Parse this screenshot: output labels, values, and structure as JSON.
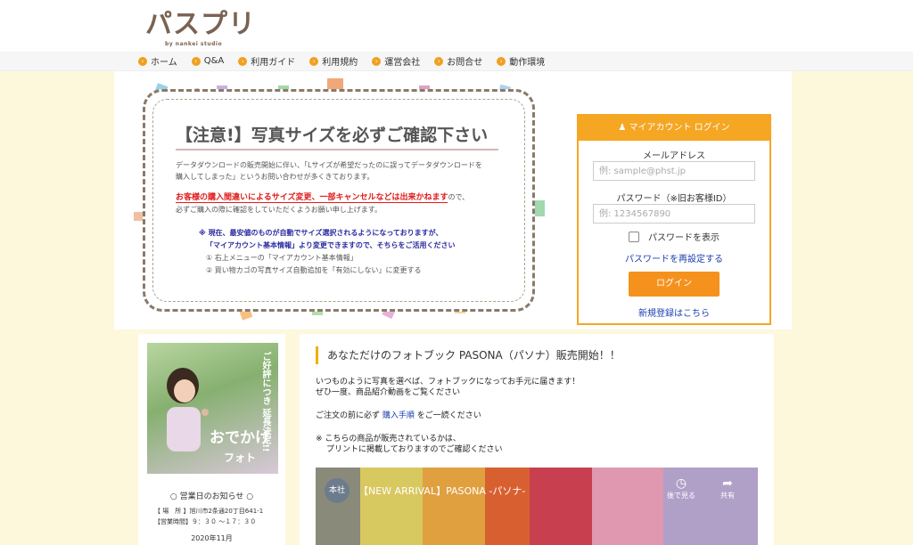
{
  "logo": {
    "main": "パスプリ",
    "sub": "by nankei studio"
  },
  "nav": {
    "items": [
      {
        "label": "ホーム"
      },
      {
        "label": "Q&A"
      },
      {
        "label": "利用ガイド"
      },
      {
        "label": "利用規約"
      },
      {
        "label": "運営会社"
      },
      {
        "label": "お問合せ"
      },
      {
        "label": "動作環境"
      }
    ]
  },
  "notice": {
    "title": "【注意!】写真サイズを必ずご確認下さい",
    "line1": "データダウンロードの販売開始に伴い、「Lサイズが希望だったのに誤ってデータダウンロードを",
    "line2": "購入してしまった」というお問い合わせが多くきております。",
    "line3_red": "お客様の購入間違いによるサイズ変更、一部キャンセルなどは出来かねます",
    "line3_rest": "ので、",
    "line4": "必ずご購入の際に確認をしていただくようお願い申し上げます。",
    "line5": "※ 現在、最安値のものが自動でサイズ選択されるようになっておりますが、",
    "line6": "「マイアカウント基本情報」より変更できますので、そちらをご活用ください",
    "line7": "① 右上メニューの「マイアカウント基本情報」",
    "line8": "② 買い物カゴの写真サイズ自動追加を「有効にしない」に変更する"
  },
  "login": {
    "header": "マイアカウント ログイン",
    "email_label": "メールアドレス",
    "email_placeholder": "例: sample@phst.jp",
    "password_label": "パスワード（※旧お客様ID）",
    "password_placeholder": "例: 1234567890",
    "show_password": "パスワードを表示",
    "reset_link": "パスワードを再設定する",
    "login_button": "ログイン",
    "register_link": "新規登録はこちら"
  },
  "sidebar": {
    "photo_text1": "ご好評につき 延長決定!!",
    "photo_text2": "おでかけ",
    "photo_text3": "フォト",
    "notice_title": "○ 営業日のお知らせ ○",
    "location": "【 場　所 】旭川市2条通20丁目641-1",
    "hours": "【営業時間】９：３０ ～１７：３０",
    "month": "2020年11月"
  },
  "main": {
    "title": "あなただけのフォトブック PASONA（パソナ）販売開始！！",
    "text1": "いつものように写真を選べば、フォトブックになってお手元に届きます！",
    "text2": "ぜひ一度、商品紹介動画をご覧ください",
    "text3_pre": "ご注文の前に必ず ",
    "text3_link": "購入手順",
    "text3_post": " をご一読ください",
    "text4": "※ こちらの商品が販売されているかは、",
    "text5": "プリントに掲載しておりますのでご確認ください"
  },
  "video": {
    "channel": "本社",
    "title": "【NEW ARRIVAL】PASONA -パソナ-",
    "watch_later": "後で見る",
    "share": "共有"
  },
  "colors": {
    "accent": "#f5a623",
    "button": "#f5921e",
    "page_bg": "#fdf8dc",
    "link": "#1a3fb0",
    "warning": "#e01a1a"
  }
}
